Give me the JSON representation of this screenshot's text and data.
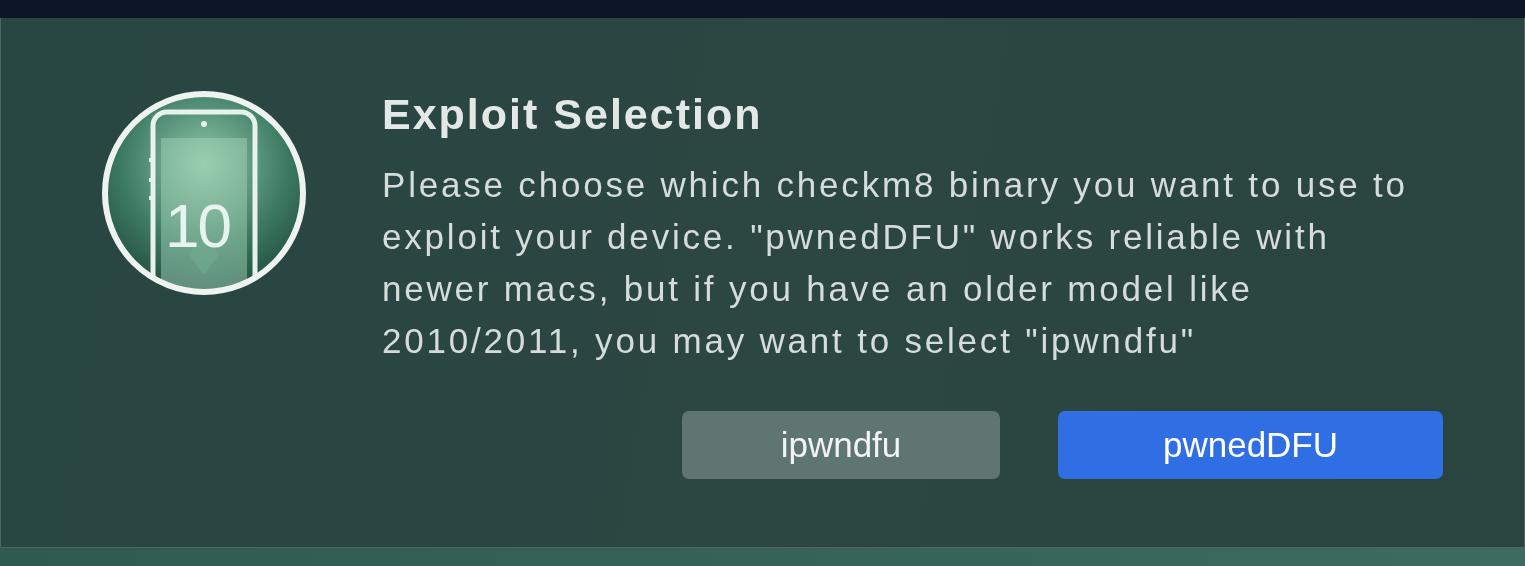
{
  "dialog": {
    "icon_label": "10",
    "title": "Exploit Selection",
    "message": "Please choose which checkm8 binary you want to use to exploit your device. \"pwnedDFU\" works reliable with newer macs, but if you have an older model like 2010/2011, you may want to select \"ipwndfu\"",
    "buttons": [
      {
        "label": "ipwndfu",
        "default": false
      },
      {
        "label": "pwnedDFU",
        "default": true
      }
    ]
  }
}
